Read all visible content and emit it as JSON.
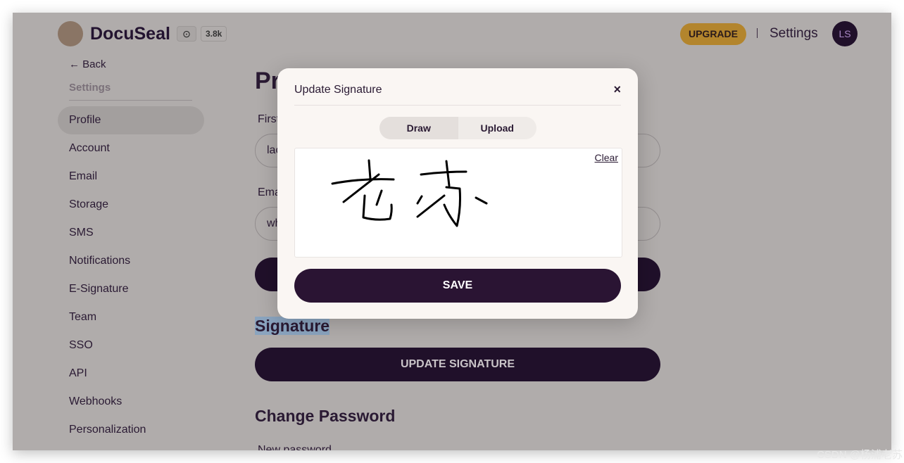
{
  "header": {
    "brand": "DocuSeal",
    "github_icon": "github-icon",
    "stars": "3.8k",
    "upgrade": "UPGRADE",
    "settings": "Settings",
    "avatar": "LS"
  },
  "sidebar": {
    "back": "← Back",
    "section": "Settings",
    "items": [
      {
        "label": "Profile",
        "active": true
      },
      {
        "label": "Account"
      },
      {
        "label": "Email"
      },
      {
        "label": "Storage"
      },
      {
        "label": "SMS"
      },
      {
        "label": "Notifications"
      },
      {
        "label": "E-Signature"
      },
      {
        "label": "Team"
      },
      {
        "label": "SSO"
      },
      {
        "label": "API"
      },
      {
        "label": "Webhooks"
      },
      {
        "label": "Personalization"
      }
    ]
  },
  "main": {
    "title": "Profile",
    "first_name_label": "First name",
    "first_name_value": "lao",
    "email_label": "Email",
    "email_value": "wh",
    "signature_heading": "Signature",
    "update_signature": "UPDATE SIGNATURE",
    "change_password": "Change Password",
    "new_password_label": "New password"
  },
  "modal": {
    "title": "Update Signature",
    "close": "×",
    "tabs": [
      {
        "label": "Draw",
        "active": true
      },
      {
        "label": "Upload"
      }
    ],
    "clear": "Clear",
    "save": "SAVE"
  },
  "watermark": "CSDN @杨浦老苏"
}
